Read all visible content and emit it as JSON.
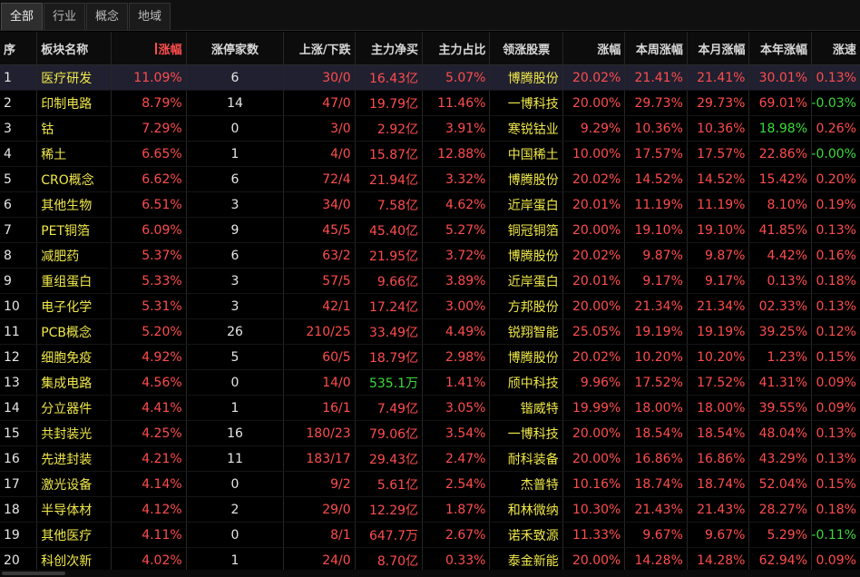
{
  "tabs": [
    {
      "label": "全部",
      "active": true
    },
    {
      "label": "行业",
      "active": false
    },
    {
      "label": "概念",
      "active": false
    },
    {
      "label": "地域",
      "active": false
    }
  ],
  "columns": [
    "序",
    "板块名称",
    "涨幅",
    "涨停家数",
    "上涨/下跌",
    "主力净买",
    "主力占比",
    "领涨股票",
    "涨幅",
    "本周涨幅",
    "本月涨幅",
    "本年涨幅",
    "涨速"
  ],
  "colors": {
    "up": "#ff4d4d",
    "down": "#3adb3a",
    "name": "#f0e84a",
    "selected_row": "#202030"
  },
  "rows": [
    {
      "idx": "1",
      "name": "医疗研发",
      "chg": "11.09%",
      "limit": "6",
      "updown": "30/0",
      "net": "16.43亿",
      "ratio": "5.07%",
      "leader": "博腾股份",
      "lchg": "20.02%",
      "week": "21.41%",
      "month": "21.41%",
      "year": "30.01%",
      "speed": "0.13%"
    },
    {
      "idx": "2",
      "name": "印制电路",
      "chg": "8.79%",
      "limit": "14",
      "updown": "47/0",
      "net": "19.79亿",
      "ratio": "11.46%",
      "leader": "一博科技",
      "lchg": "20.00%",
      "week": "29.73%",
      "month": "29.73%",
      "year": "69.01%",
      "speed": "-0.03%"
    },
    {
      "idx": "3",
      "name": "钴",
      "chg": "7.29%",
      "limit": "0",
      "updown": "3/0",
      "net": "2.92亿",
      "ratio": "3.91%",
      "leader": "寒锐钴业",
      "lchg": "9.29%",
      "week": "10.36%",
      "month": "10.36%",
      "year": "18.98%",
      "speed": "0.26%"
    },
    {
      "idx": "4",
      "name": "稀土",
      "chg": "6.65%",
      "limit": "1",
      "updown": "4/0",
      "net": "15.87亿",
      "ratio": "12.88%",
      "leader": "中国稀土",
      "lchg": "10.00%",
      "week": "17.57%",
      "month": "17.57%",
      "year": "22.86%",
      "speed": "-0.00%"
    },
    {
      "idx": "5",
      "name": "CRO概念",
      "chg": "6.62%",
      "limit": "6",
      "updown": "72/4",
      "net": "21.94亿",
      "ratio": "3.32%",
      "leader": "博腾股份",
      "lchg": "20.02%",
      "week": "14.52%",
      "month": "14.52%",
      "year": "15.42%",
      "speed": "0.20%"
    },
    {
      "idx": "6",
      "name": "其他生物",
      "chg": "6.51%",
      "limit": "3",
      "updown": "34/0",
      "net": "7.58亿",
      "ratio": "4.62%",
      "leader": "近岸蛋白",
      "lchg": "20.01%",
      "week": "11.19%",
      "month": "11.19%",
      "year": "8.10%",
      "speed": "0.19%"
    },
    {
      "idx": "7",
      "name": "PET铜箔",
      "chg": "6.09%",
      "limit": "9",
      "updown": "45/5",
      "net": "45.40亿",
      "ratio": "5.27%",
      "leader": "铜冠铜箔",
      "lchg": "20.00%",
      "week": "19.10%",
      "month": "19.10%",
      "year": "41.85%",
      "speed": "0.13%"
    },
    {
      "idx": "8",
      "name": "减肥药",
      "chg": "5.37%",
      "limit": "6",
      "updown": "63/2",
      "net": "21.95亿",
      "ratio": "3.72%",
      "leader": "博腾股份",
      "lchg": "20.02%",
      "week": "9.87%",
      "month": "9.87%",
      "year": "4.42%",
      "speed": "0.16%"
    },
    {
      "idx": "9",
      "name": "重组蛋白",
      "chg": "5.33%",
      "limit": "3",
      "updown": "57/5",
      "net": "9.66亿",
      "ratio": "3.89%",
      "leader": "近岸蛋白",
      "lchg": "20.01%",
      "week": "9.17%",
      "month": "9.17%",
      "year": "0.13%",
      "speed": "0.18%"
    },
    {
      "idx": "10",
      "name": "电子化学",
      "chg": "5.31%",
      "limit": "3",
      "updown": "42/1",
      "net": "17.24亿",
      "ratio": "3.00%",
      "leader": "方邦股份",
      "lchg": "20.00%",
      "week": "21.34%",
      "month": "21.34%",
      "year": "02.33%",
      "speed": "0.13%"
    },
    {
      "idx": "11",
      "name": "PCB概念",
      "chg": "5.20%",
      "limit": "26",
      "updown": "210/25",
      "net": "33.49亿",
      "ratio": "4.49%",
      "leader": "锐翔智能",
      "lchg": "25.05%",
      "week": "19.19%",
      "month": "19.19%",
      "year": "39.25%",
      "speed": "0.12%"
    },
    {
      "idx": "12",
      "name": "细胞免疫",
      "chg": "4.92%",
      "limit": "5",
      "updown": "60/5",
      "net": "18.79亿",
      "ratio": "2.98%",
      "leader": "博腾股份",
      "lchg": "20.02%",
      "week": "10.20%",
      "month": "10.20%",
      "year": "1.23%",
      "speed": "0.15%"
    },
    {
      "idx": "13",
      "name": "集成电路",
      "chg": "4.56%",
      "limit": "0",
      "updown": "14/0",
      "net": "535.1万",
      "ratio": "1.41%",
      "leader": "颀中科技",
      "lchg": "9.96%",
      "week": "17.52%",
      "month": "17.52%",
      "year": "41.31%",
      "speed": "0.09%"
    },
    {
      "idx": "14",
      "name": "分立器件",
      "chg": "4.41%",
      "limit": "1",
      "updown": "16/1",
      "net": "7.49亿",
      "ratio": "3.05%",
      "leader": "锴威特",
      "lchg": "19.99%",
      "week": "18.00%",
      "month": "18.00%",
      "year": "39.55%",
      "speed": "0.09%"
    },
    {
      "idx": "15",
      "name": "共封装光",
      "chg": "4.25%",
      "limit": "16",
      "updown": "180/23",
      "net": "79.06亿",
      "ratio": "3.54%",
      "leader": "一博科技",
      "lchg": "20.00%",
      "week": "18.54%",
      "month": "18.54%",
      "year": "48.04%",
      "speed": "0.13%"
    },
    {
      "idx": "16",
      "name": "先进封装",
      "chg": "4.21%",
      "limit": "11",
      "updown": "183/17",
      "net": "29.43亿",
      "ratio": "2.47%",
      "leader": "耐科装备",
      "lchg": "20.00%",
      "week": "16.86%",
      "month": "16.86%",
      "year": "43.29%",
      "speed": "0.13%"
    },
    {
      "idx": "17",
      "name": "激光设备",
      "chg": "4.14%",
      "limit": "0",
      "updown": "9/2",
      "net": "5.61亿",
      "ratio": "2.54%",
      "leader": "杰普特",
      "lchg": "10.16%",
      "week": "18.74%",
      "month": "18.74%",
      "year": "52.04%",
      "speed": "0.15%"
    },
    {
      "idx": "18",
      "name": "半导体材",
      "chg": "4.12%",
      "limit": "2",
      "updown": "29/0",
      "net": "12.29亿",
      "ratio": "1.87%",
      "leader": "和林微纳",
      "lchg": "10.30%",
      "week": "21.43%",
      "month": "21.43%",
      "year": "28.27%",
      "speed": "0.18%"
    },
    {
      "idx": "19",
      "name": "其他医疗",
      "chg": "4.11%",
      "limit": "0",
      "updown": "8/1",
      "net": "647.7万",
      "ratio": "2.67%",
      "leader": "诺禾致源",
      "lchg": "11.33%",
      "week": "9.67%",
      "month": "9.67%",
      "year": "5.29%",
      "speed": "-0.11%"
    },
    {
      "idx": "20",
      "name": "科创次新",
      "chg": "4.02%",
      "limit": "1",
      "updown": "24/0",
      "net": "8.70亿",
      "ratio": "0.33%",
      "leader": "泰金新能",
      "lchg": "20.00%",
      "week": "14.28%",
      "month": "14.28%",
      "year": "62.94%",
      "speed": "0.09%"
    }
  ],
  "green_cells": [
    [
      2,
      "speed"
    ],
    [
      3,
      "year"
    ],
    [
      4,
      "speed"
    ],
    [
      13,
      "net"
    ],
    [
      19,
      "speed"
    ]
  ]
}
